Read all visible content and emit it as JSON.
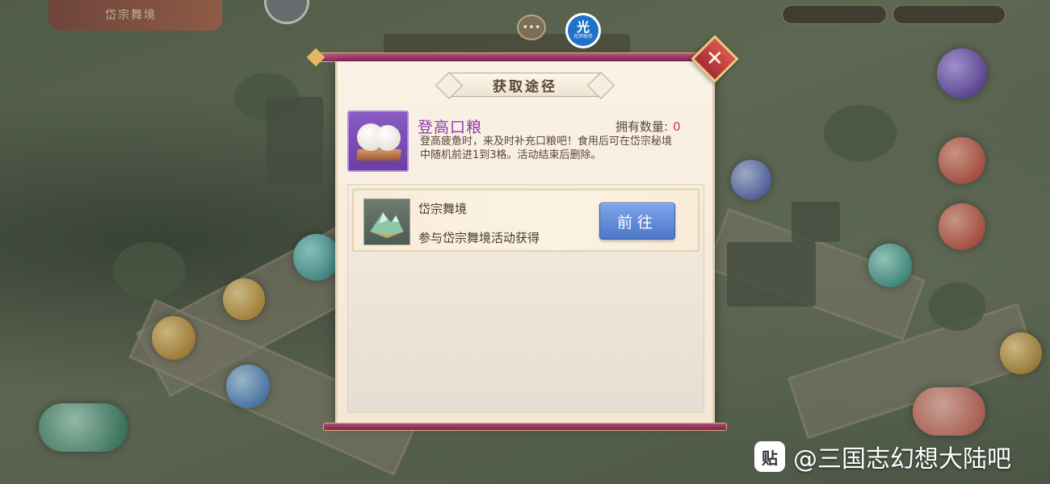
{
  "hud": {
    "event_banner": "岱宗舞境",
    "chat_icon": "chat-bubble-icon",
    "logo": {
      "big": "光",
      "small": "光环助手"
    }
  },
  "popup": {
    "title": "获取途径",
    "close_icon": "close-icon",
    "item": {
      "name": "登高口粮",
      "owned_label": "拥有数量:",
      "owned_count": "0",
      "description": "登高疲惫时，来及时补充口粮吧！食用后可在岱宗秘境中随机前进1到3格。活动结束后删除。",
      "icon": "steamed-bun-icon"
    },
    "sources": [
      {
        "name": "岱宗舞境",
        "description": "参与岱宗舞境活动获得",
        "button_label": "前往",
        "icon": "mountain-icon"
      }
    ]
  },
  "watermark": {
    "icon": "贴",
    "text": "@三国志幻想大陆吧"
  },
  "colors": {
    "item_name": "#8e3aa6",
    "owned_count": "#d23a3a",
    "go_button": "#5a82d6",
    "panel_bar": "#a63c6c"
  }
}
